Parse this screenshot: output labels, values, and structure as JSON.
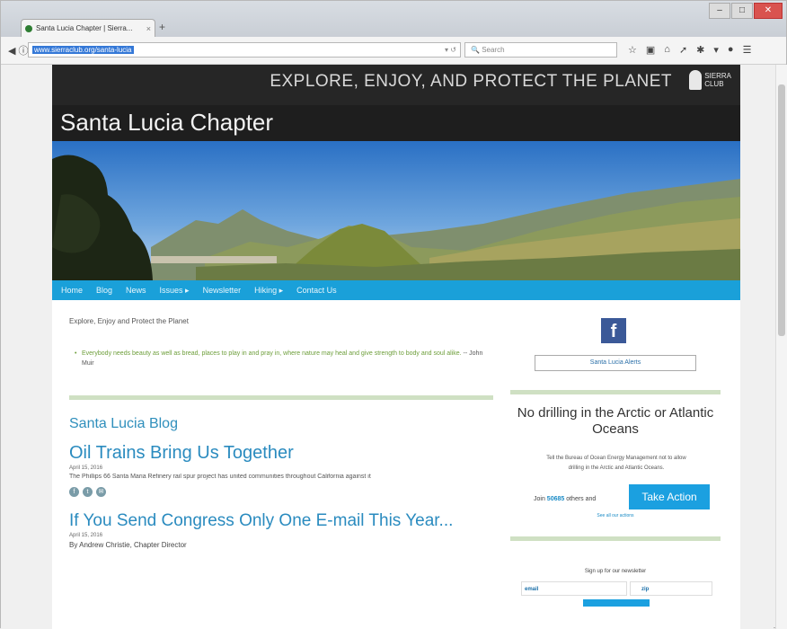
{
  "browser": {
    "tab_title": "Santa Lucia Chapter | Sierra...",
    "tab_close": "×",
    "new_tab": "+",
    "url_text": "www.sierraclub.org/santa-lucia",
    "url_dropdown": "▾ ↺",
    "search_placeholder": "Search",
    "toolbar_icons": [
      "star-icon",
      "clipboard-icon",
      "home-icon",
      "send-icon",
      "extension-icon",
      "chevron-icon",
      "shield-icon",
      "menu-icon"
    ],
    "window_controls": {
      "minimize": "–",
      "maximize": "□",
      "close": "✕"
    }
  },
  "header": {
    "tagline": "EXPLORE, ENJOY, AND PROTECT THE PLANET",
    "logo_text_1": "SIERRA",
    "logo_text_2": "CLUB",
    "chapter_title": "Santa Lucia Chapter"
  },
  "nav": {
    "items": [
      {
        "label": "Home"
      },
      {
        "label": "Blog"
      },
      {
        "label": "News"
      },
      {
        "label": "Issues ▸"
      },
      {
        "label": "Newsletter"
      },
      {
        "label": "Hiking ▸"
      },
      {
        "label": "Contact Us"
      }
    ]
  },
  "main": {
    "intro": "Explore, Enjoy and Protect the Planet",
    "quote": "Everybody needs beauty as well as bread, places to play in and pray in, where nature may heal and give strength to body and soul alike.",
    "quote_attribution": "-- John Muir",
    "blog_heading": "Santa Lucia Blog",
    "posts": [
      {
        "title": "Oil Trains Bring Us Together",
        "date": "April 15, 2016",
        "excerpt": "The Phillips 66 Santa Maria Refinery rail spur project has united communities throughout California against it"
      },
      {
        "title": "If You Send Congress Only One E-mail This Year...",
        "date": "April 15, 2016",
        "byline": "By Andrew Christie, Chapter Director"
      }
    ]
  },
  "sidebar": {
    "facebook_letter": "f",
    "alerts_label": "Santa Lucia Alerts",
    "campaign_heading": "No drilling in the Arctic or Atlantic Oceans",
    "campaign_text": "Tell the Bureau of Ocean Energy Management not to allow drilling in the Arctic and Atlantic Oceans.",
    "join_prefix": "Join",
    "join_count": "50685",
    "join_suffix": "others and",
    "action_button": "Take Action",
    "see_all": "See all our actions",
    "signup_text": "Sign up for our newsletter",
    "email_label": "email",
    "zip_label": "zip"
  },
  "colors": {
    "nav_bar": "#1aa0d9",
    "link_blue": "#2a8bbf",
    "header_dark": "#262626",
    "divider_green": "#cfe0c3",
    "facebook": "#3b5998",
    "action_button": "#1ba0e0"
  }
}
